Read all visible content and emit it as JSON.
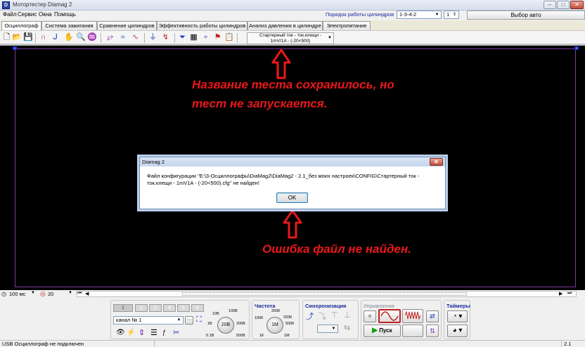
{
  "window": {
    "title": "Мотортестер Diamag 2",
    "icon_label": "D",
    "minimize": "–",
    "maximize": "□",
    "close": "✕"
  },
  "menu": [
    "Файл",
    "Сервис",
    "Окна",
    "Помощь"
  ],
  "cylinder_order": {
    "label": "Порядок работы цилиндров",
    "value": "1-3-4-2",
    "count_value": "1"
  },
  "choose_auto_label": "Выбор авто",
  "tabs": [
    "Осциллограф",
    "Система зажигания",
    "Сравнение цилиндров",
    "Эффективность работы цилиндров",
    "Анализ давления в цилиндре",
    "Электропитание"
  ],
  "toolbar": {
    "test_name_line1": "Стартерный ток - ток.клещи -",
    "test_name_line2": "1mV/1A - (-20<500)",
    "marker_left": "1",
    "marker_right": "2"
  },
  "annotations": {
    "top_line1": "Название теста сохранилось, но",
    "top_line2": "тест не запускается.",
    "bottom": "Ошибка файл не найден."
  },
  "dialog": {
    "title": "Diamag 2",
    "message": "Файл конфигурации \"E:\\3-Осциллографы\\DiaMag2\\DiaMag2 - 2.1_без моих настроек\\CONFIG\\Стартерный ток - ток.клещи - 1mV1A - (-20<500).cfg\" не найден!",
    "ok_label": "OK"
  },
  "controls": {
    "timebase": "100 мс",
    "channel_amp": "20"
  },
  "channel_panel": {
    "channel_buttons": [
      "1",
      "2",
      "3",
      "4",
      "5",
      "6"
    ],
    "channel_select": "канал № 1",
    "more": "···",
    "knob_value": "20В",
    "ticks": [
      "0.1В",
      "1В",
      "10В",
      "100В",
      "200В",
      "500В"
    ]
  },
  "frequency": {
    "title": "Частота",
    "knob_value": "1М",
    "ticks": [
      "1К",
      "100К",
      "250К",
      "333К",
      "500К",
      "1М"
    ]
  },
  "sync": {
    "title": "Синхронизация"
  },
  "control": {
    "title": "Управление",
    "start_label": "Пуск"
  },
  "timers": {
    "title": "Таймеры"
  },
  "status": {
    "left": "USB Осциллограф не подключен",
    "version": "2.1"
  },
  "colors": {
    "annotation": "#e8181a",
    "scope_bg": "#000000",
    "frame": "#7a3aa0",
    "group_title": "#1a2a9a"
  }
}
